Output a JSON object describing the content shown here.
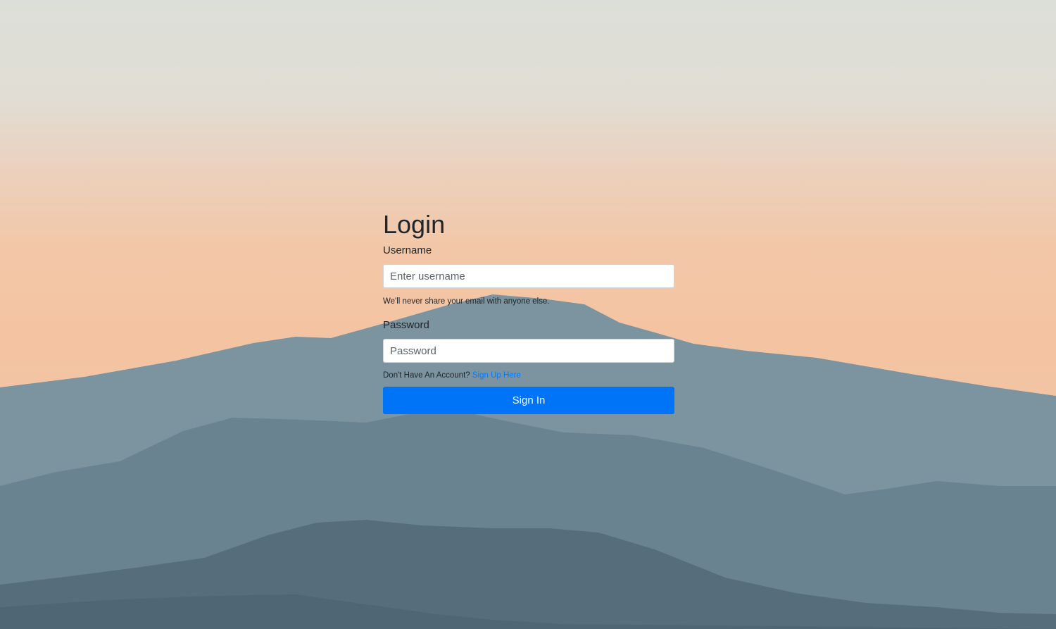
{
  "login": {
    "title": "Login",
    "username_label": "Username",
    "username_placeholder": "Enter username",
    "username_value": "",
    "help_text": "We'll never share your email with anyone else.",
    "password_label": "Password",
    "password_placeholder": "Password",
    "password_value": "",
    "signup_prompt": "Don't Have An Account?",
    "signup_link": "Sign Up Here",
    "submit_label": "Sign In"
  },
  "colors": {
    "primary": "#0074f7",
    "link": "#007bff",
    "text": "#212529",
    "sky_top": "#dcdfd9",
    "sky_horizon": "#f4c4a2",
    "mountain_far": "#7b939f",
    "mountain_mid": "#647f8d",
    "mountain_near": "#4f6674"
  }
}
